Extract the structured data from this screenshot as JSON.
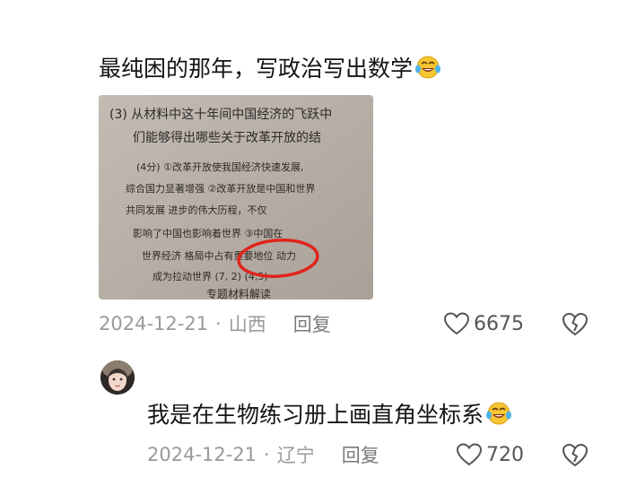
{
  "comments": [
    {
      "text": "最纯困的那年，写政治写出数学",
      "emoji": "laughing-tears-emoji",
      "date": "2024-12-21",
      "location": "山西",
      "reply_label": "回复",
      "likes": "6675",
      "photo": {
        "lines": [
          "(3) 从材料中这十年间中国经济的飞跃中",
          "们能够得出哪些关于改革开放的结",
          "(4分) ①改革开放使我国经济快速发展,",
          "综合国力显著增强 ②改革开放是中国和世界",
          "共同发展 进步的伟大历程，不仅",
          "影响了中国也影响着世界 ③中国在",
          "世界经济 格局中占有重要地位 动力",
          "成为拉动世界 (7, 2) (4,5)",
          "专题材料解读"
        ]
      }
    },
    {
      "text": "我是在生物练习册上画直角坐标系",
      "emoji": "laughing-tears-emoji",
      "date": "2024-12-21",
      "location": "辽宁",
      "reply_label": "回复",
      "likes": "720"
    }
  ],
  "colors": {
    "meta_gray": "#9a9a9a",
    "red_circle": "#e0241b",
    "emoji_yellow": "#f7c531"
  }
}
